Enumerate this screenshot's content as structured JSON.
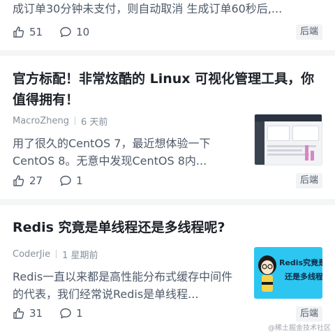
{
  "feed": [
    {
      "excerpt": "成订单30分钟未支付，则自动取消 生成订单60秒后,...",
      "likes": "51",
      "comments": "10",
      "tag": "后端"
    },
    {
      "title": "官方标配！非常炫酷的 Linux 可视化管理工具，你值得拥有！",
      "author": "MacroZheng",
      "time": "6 天前",
      "excerpt": "用了很久的CentOS 7，最近想体验一下CentOS 8。无意中发现CentOS 8内...",
      "likes": "27",
      "comments": "1",
      "tag": "后端"
    },
    {
      "title": "Redis 究竟是单线程还是多线程呢?",
      "author": "CoderJie",
      "time": "1 星期前",
      "excerpt": "Redis一直以来都是高性能分布式缓存中间件的代表，我们经常说Redis是单线程...",
      "thumb_line1": "Redis究竟是单线",
      "thumb_line2": "还是多线程",
      "likes": "31",
      "comments": "1",
      "tag": "后端"
    }
  ],
  "watermark": "@稀土掘金技术社区",
  "colors": {
    "background": "#f4f5f5",
    "card": "#ffffff",
    "title": "#1d2129",
    "meta": "#86909c",
    "excerpt": "#4e5969",
    "tag_bg": "#f2f3f5",
    "redis_thumb_bg": "#2dc6f0"
  },
  "icons": [
    "thumbs-up-icon",
    "comment-icon"
  ]
}
